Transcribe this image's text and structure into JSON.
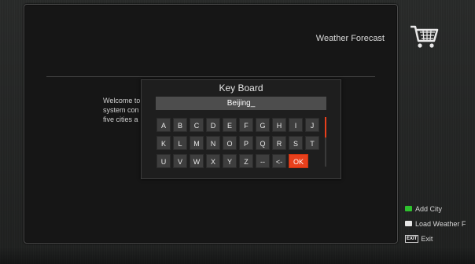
{
  "page": {
    "title": "Weather Forecast",
    "welcome_text": "Welcome to\nsystem con\nfive cities a"
  },
  "keyboard": {
    "title": "Key Board",
    "input_value": "Beijing_",
    "rows": [
      [
        "A",
        "B",
        "C",
        "D",
        "E",
        "F",
        "G",
        "H",
        "I",
        "J"
      ],
      [
        "K",
        "L",
        "M",
        "N",
        "O",
        "P",
        "Q",
        "R",
        "S",
        "T"
      ],
      [
        "U",
        "V",
        "W",
        "X",
        "Y",
        "Z",
        "--",
        "<-",
        "OK"
      ]
    ]
  },
  "legend": {
    "add_city": "Add City",
    "load_weather": "Load Weather F",
    "exit_key": "EXIT",
    "exit": "Exit"
  },
  "colors": {
    "accent": "#e8401c",
    "green": "#2ec22e",
    "white_key": "#e6e6e6"
  },
  "icons": {
    "side": "shopping-cart-icon"
  }
}
